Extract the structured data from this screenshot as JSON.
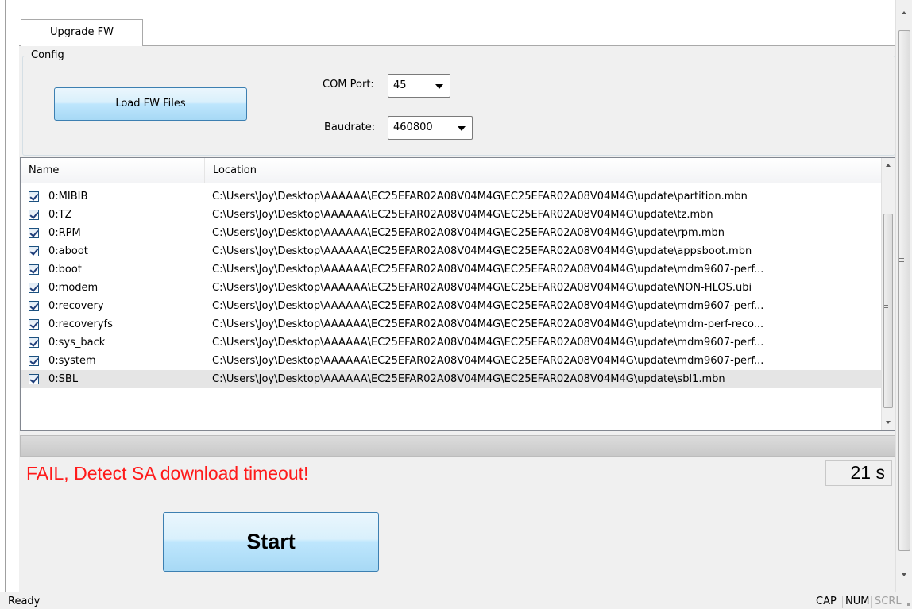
{
  "tabs": [
    {
      "label": "Upgrade FW"
    }
  ],
  "config": {
    "legend": "Config",
    "load_button": "Load FW Files",
    "com_port_label": "COM Port:",
    "com_port_value": "45",
    "baudrate_label": "Baudrate:",
    "baudrate_value": "460800"
  },
  "file_list": {
    "columns": [
      "Name",
      "Location"
    ],
    "rows": [
      {
        "name": "0:MIBIB",
        "location": "C:\\Users\\Joy\\Desktop\\AAAAAA\\EC25EFAR02A08V04M4G\\EC25EFAR02A08V04M4G\\update\\partition.mbn",
        "checked": true
      },
      {
        "name": "0:TZ",
        "location": "C:\\Users\\Joy\\Desktop\\AAAAAA\\EC25EFAR02A08V04M4G\\EC25EFAR02A08V04M4G\\update\\tz.mbn",
        "checked": true
      },
      {
        "name": "0:RPM",
        "location": "C:\\Users\\Joy\\Desktop\\AAAAAA\\EC25EFAR02A08V04M4G\\EC25EFAR02A08V04M4G\\update\\rpm.mbn",
        "checked": true
      },
      {
        "name": "0:aboot",
        "location": "C:\\Users\\Joy\\Desktop\\AAAAAA\\EC25EFAR02A08V04M4G\\EC25EFAR02A08V04M4G\\update\\appsboot.mbn",
        "checked": true
      },
      {
        "name": "0:boot",
        "location": "C:\\Users\\Joy\\Desktop\\AAAAAA\\EC25EFAR02A08V04M4G\\EC25EFAR02A08V04M4G\\update\\mdm9607-perf...",
        "checked": true
      },
      {
        "name": "0:modem",
        "location": "C:\\Users\\Joy\\Desktop\\AAAAAA\\EC25EFAR02A08V04M4G\\EC25EFAR02A08V04M4G\\update\\NON-HLOS.ubi",
        "checked": true
      },
      {
        "name": "0:recovery",
        "location": "C:\\Users\\Joy\\Desktop\\AAAAAA\\EC25EFAR02A08V04M4G\\EC25EFAR02A08V04M4G\\update\\mdm9607-perf...",
        "checked": true
      },
      {
        "name": "0:recoveryfs",
        "location": "C:\\Users\\Joy\\Desktop\\AAAAAA\\EC25EFAR02A08V04M4G\\EC25EFAR02A08V04M4G\\update\\mdm-perf-reco...",
        "checked": true
      },
      {
        "name": "0:sys_back",
        "location": "C:\\Users\\Joy\\Desktop\\AAAAAA\\EC25EFAR02A08V04M4G\\EC25EFAR02A08V04M4G\\update\\mdm9607-perf...",
        "checked": true
      },
      {
        "name": "0:system",
        "location": "C:\\Users\\Joy\\Desktop\\AAAAAA\\EC25EFAR02A08V04M4G\\EC25EFAR02A08V04M4G\\update\\mdm9607-perf...",
        "checked": true
      },
      {
        "name": "0:SBL",
        "location": "C:\\Users\\Joy\\Desktop\\AAAAAA\\EC25EFAR02A08V04M4G\\EC25EFAR02A08V04M4G\\update\\sbl1.mbn",
        "checked": true,
        "selected": true
      }
    ]
  },
  "progress": {
    "fraction": 0
  },
  "status": {
    "message": "FAIL, Detect SA download timeout!",
    "message_color": "#ff1a1a",
    "elapsed": "21 s"
  },
  "start_button": "Start",
  "statusbar": {
    "text": "Ready",
    "indicators": [
      {
        "label": "CAP",
        "active": true
      },
      {
        "label": "NUM",
        "active": true
      },
      {
        "label": "SCRL",
        "active": false
      }
    ]
  },
  "colors": {
    "button_border": "#3c7fb1",
    "button_fill": "#bee6fd"
  }
}
